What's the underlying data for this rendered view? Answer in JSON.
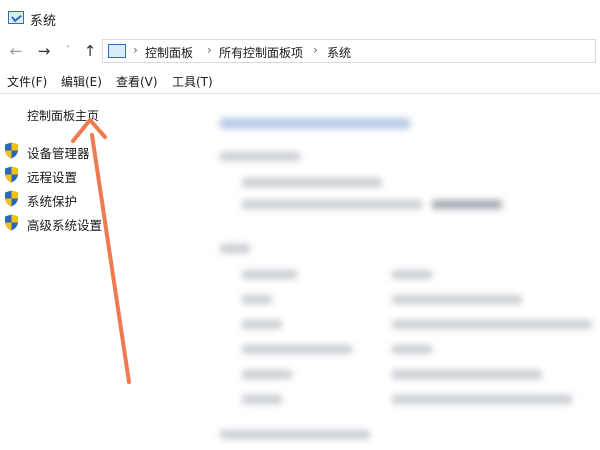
{
  "window": {
    "title": "系统",
    "icon": "system-monitor-icon"
  },
  "nav": {
    "back_icon": "arrow-left-icon",
    "forward_icon": "arrow-right-icon",
    "recent_icon": "chevron-down-icon",
    "up_icon": "arrow-up-icon"
  },
  "address": {
    "sep1": "›",
    "crumb1": "控制面板",
    "sep2": "›",
    "crumb2": "所有控制面板项",
    "sep3": "›",
    "crumb3": "系统"
  },
  "menu": {
    "file": "文件(F)",
    "edit": "编辑(E)",
    "view": "查看(V)",
    "tools": "工具(T)"
  },
  "sidebar": {
    "home": "控制面板主页",
    "items": [
      {
        "label": "设备管理器",
        "icon": "uac-shield-icon"
      },
      {
        "label": "远程设置",
        "icon": "uac-shield-icon"
      },
      {
        "label": "系统保护",
        "icon": "uac-shield-icon"
      },
      {
        "label": "高级系统设置",
        "icon": "uac-shield-icon"
      }
    ]
  },
  "colors": {
    "annotation_arrow": "#f07a4f",
    "shield_blue": "#2b65c2",
    "shield_yellow": "#f4c20d",
    "accent_blue": "#2a6fb8"
  }
}
